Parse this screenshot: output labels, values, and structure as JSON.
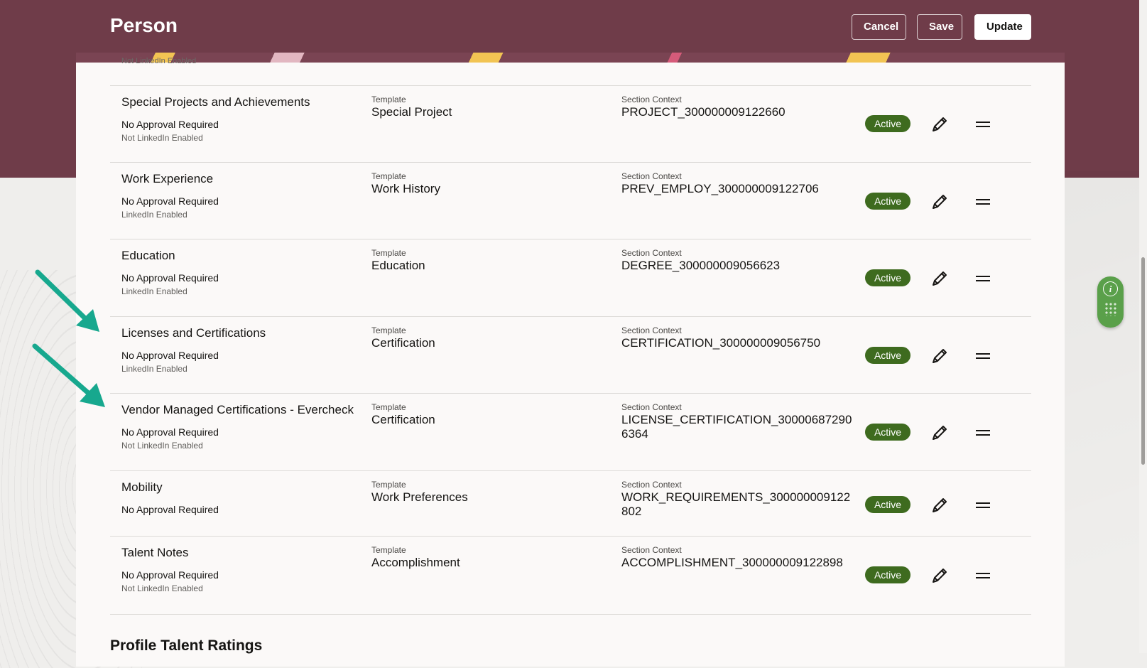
{
  "header": {
    "title": "Person",
    "buttons": {
      "cancel": "Cancel",
      "save": "Save",
      "update": "Update"
    }
  },
  "cutoff_row": {
    "linkedin": "Not LinkedIn Enabled"
  },
  "labels": {
    "template": "Template",
    "section_context": "Section Context"
  },
  "sections": [
    {
      "title": "Special Projects and Achievements",
      "approval": "No Approval Required",
      "linkedin": "Not LinkedIn Enabled",
      "template": "Special Project",
      "context": "PROJECT_300000009122660",
      "status": "Active"
    },
    {
      "title": "Work Experience",
      "approval": "No Approval Required",
      "linkedin": "LinkedIn Enabled",
      "template": "Work History",
      "context": "PREV_EMPLOY_300000009122706",
      "status": "Active"
    },
    {
      "title": "Education",
      "approval": "No Approval Required",
      "linkedin": "LinkedIn Enabled",
      "template": "Education",
      "context": "DEGREE_300000009056623",
      "status": "Active"
    },
    {
      "title": "Licenses and Certifications",
      "approval": "No Approval Required",
      "linkedin": "LinkedIn Enabled",
      "template": "Certification",
      "context": "CERTIFICATION_300000009056750",
      "status": "Active"
    },
    {
      "title": "Vendor Managed Certifications - Evercheck",
      "approval": "No Approval Required",
      "linkedin": "Not LinkedIn Enabled",
      "template": "Certification",
      "context": "LICENSE_CERTIFICATION_300006872906364",
      "status": "Active"
    },
    {
      "title": "Mobility",
      "approval": "No Approval Required",
      "linkedin": "",
      "template": "Work Preferences",
      "context": "WORK_REQUIREMENTS_300000009122802",
      "status": "Active"
    },
    {
      "title": "Talent Notes",
      "approval": "No Approval Required",
      "linkedin": "Not LinkedIn Enabled",
      "template": "Accomplishment",
      "context": "ACCOMPLISHMENT_300000009122898",
      "status": "Active"
    }
  ],
  "next_section": {
    "title": "Profile Talent Ratings"
  },
  "help_widget": {
    "icon": "info-icon",
    "letter": "i"
  },
  "colors": {
    "header_band": "#6f3c49",
    "active_badge": "#3e6b1f",
    "arrow": "#17a88e",
    "help_widget": "#5aa04a"
  }
}
